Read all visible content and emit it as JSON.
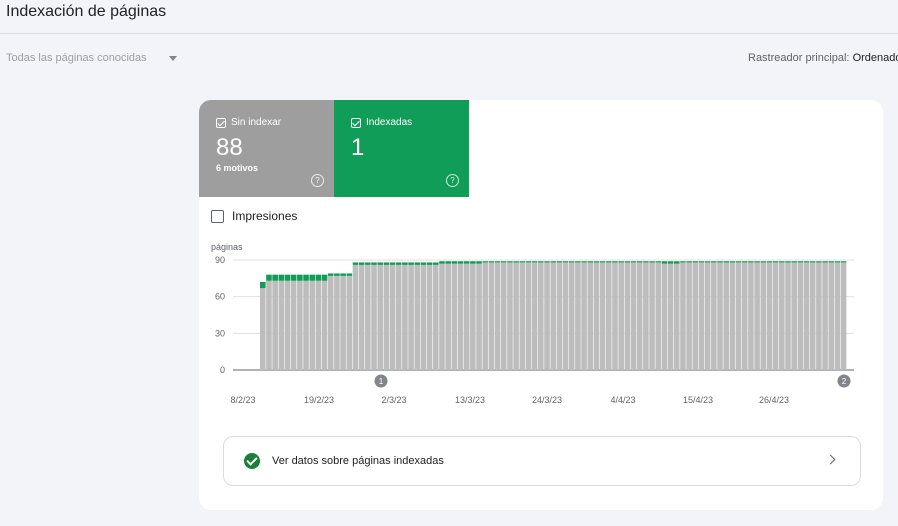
{
  "header": {
    "title": "Indexación de páginas"
  },
  "filter": {
    "label": "Todas las páginas conocidas",
    "icon": "chevron-down-icon"
  },
  "crawler": {
    "label": "Rastreador principal: ",
    "value": "Ordenador"
  },
  "tiles": [
    {
      "label": "Sin indexar",
      "value": "88",
      "sub": "6 motivos",
      "color": "#9e9e9e",
      "checked": true,
      "help_icon": "help-circle-icon"
    },
    {
      "label": "Indexadas",
      "value": "1",
      "sub": "",
      "color": "#109d58",
      "checked": true,
      "help_icon": "help-circle-icon"
    }
  ],
  "impressions": {
    "label": "Impresiones",
    "checked": false
  },
  "chart_data": {
    "type": "bar",
    "stacked": true,
    "ylabel": "páginas",
    "yticks": [
      0,
      30,
      60,
      90
    ],
    "ylim": [
      0,
      90
    ],
    "xtick_labels": [
      "8/2/23",
      "19/2/23",
      "2/3/23",
      "13/3/23",
      "24/3/23",
      "4/4/23",
      "15/4/23",
      "26/4/23"
    ],
    "series_colors": {
      "Sin indexar": "#bdbdbd",
      "Indexadas": "#109d58"
    },
    "segments": [
      {
        "days": 1,
        "sin_indexar": 67,
        "indexadas": 5
      },
      {
        "days": 10,
        "sin_indexar": 73,
        "indexadas": 5
      },
      {
        "days": 4,
        "sin_indexar": 77,
        "indexadas": 2
      },
      {
        "days": 14,
        "sin_indexar": 86,
        "indexadas": 2
      },
      {
        "days": 7,
        "sin_indexar": 87,
        "indexadas": 2
      },
      {
        "days": 29,
        "sin_indexar": 88,
        "indexadas": 1
      },
      {
        "days": 3,
        "sin_indexar": 87,
        "indexadas": 2
      },
      {
        "days": 27,
        "sin_indexar": 88,
        "indexadas": 1
      }
    ],
    "annotations": [
      {
        "label": "1",
        "date": "2/3/23"
      },
      {
        "label": "2",
        "date_index": "last"
      }
    ]
  },
  "cta": {
    "label": "Ver datos sobre páginas indexadas",
    "icon": "check-circle-icon",
    "chevron": "chevron-right-icon"
  }
}
